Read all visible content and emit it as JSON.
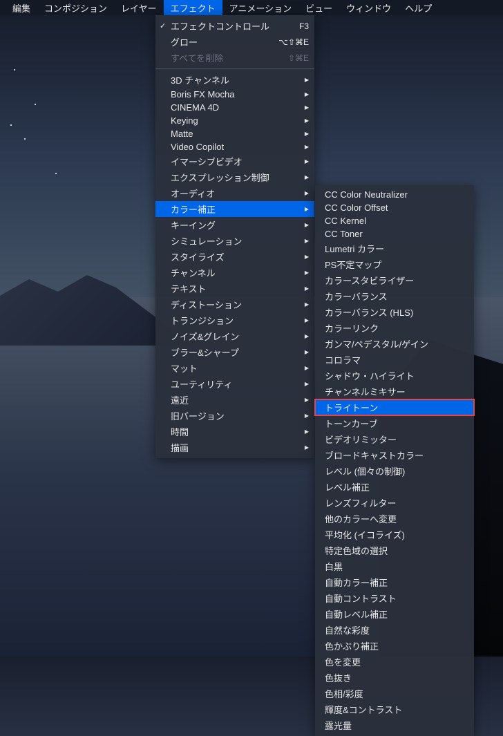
{
  "menubar": {
    "items": [
      {
        "label": "編集"
      },
      {
        "label": "コンポジション"
      },
      {
        "label": "レイヤー"
      },
      {
        "label": "エフェクト",
        "active": true
      },
      {
        "label": "アニメーション"
      },
      {
        "label": "ビュー"
      },
      {
        "label": "ウィンドウ"
      },
      {
        "label": "ヘルプ"
      }
    ]
  },
  "primary_menu": {
    "top_items": [
      {
        "label": "エフェクトコントロール",
        "checked": true,
        "shortcut": "F3"
      },
      {
        "label": "グロー",
        "shortcut": "⌥⇧⌘E"
      },
      {
        "label": "すべてを削除",
        "shortcut": "⇧⌘E",
        "disabled": true
      }
    ],
    "category_items": [
      {
        "label": "3D チャンネル"
      },
      {
        "label": "Boris FX Mocha"
      },
      {
        "label": "CINEMA 4D"
      },
      {
        "label": "Keying"
      },
      {
        "label": "Matte"
      },
      {
        "label": "Video Copilot"
      },
      {
        "label": "イマーシブビデオ"
      },
      {
        "label": "エクスプレッション制御"
      },
      {
        "label": "オーディオ"
      },
      {
        "label": "カラー補正",
        "highlighted": true
      },
      {
        "label": "キーイング"
      },
      {
        "label": "シミュレーション"
      },
      {
        "label": "スタイライズ"
      },
      {
        "label": "チャンネル"
      },
      {
        "label": "テキスト"
      },
      {
        "label": "ディストーション"
      },
      {
        "label": "トランジション"
      },
      {
        "label": "ノイズ&グレイン"
      },
      {
        "label": "ブラー&シャープ"
      },
      {
        "label": "マット"
      },
      {
        "label": "ユーティリティ"
      },
      {
        "label": "遠近"
      },
      {
        "label": "旧バージョン"
      },
      {
        "label": "時間"
      },
      {
        "label": "描画"
      }
    ]
  },
  "sub_menu": {
    "items": [
      {
        "label": "CC Color Neutralizer"
      },
      {
        "label": "CC Color Offset"
      },
      {
        "label": "CC Kernel"
      },
      {
        "label": "CC Toner"
      },
      {
        "label": "Lumetri カラー"
      },
      {
        "label": "PS不定マップ"
      },
      {
        "label": "カラースタビライザー"
      },
      {
        "label": "カラーバランス"
      },
      {
        "label": "カラーバランス (HLS)"
      },
      {
        "label": "カラーリンク"
      },
      {
        "label": "ガンマ/ペデスタル/ゲイン"
      },
      {
        "label": "コロラマ"
      },
      {
        "label": "シャドウ・ハイライト"
      },
      {
        "label": "チャンネルミキサー"
      },
      {
        "label": "トライトーン",
        "highlighted_red": true
      },
      {
        "label": "トーンカーブ"
      },
      {
        "label": "ビデオリミッター"
      },
      {
        "label": "ブロードキャストカラー"
      },
      {
        "label": "レベル (個々の制御)"
      },
      {
        "label": "レベル補正"
      },
      {
        "label": "レンズフィルター"
      },
      {
        "label": "他のカラーへ変更"
      },
      {
        "label": "平均化 (イコライズ)"
      },
      {
        "label": "特定色域の選択"
      },
      {
        "label": "白黒"
      },
      {
        "label": "自動カラー補正"
      },
      {
        "label": "自動コントラスト"
      },
      {
        "label": "自動レベル補正"
      },
      {
        "label": "自然な彩度"
      },
      {
        "label": "色かぶり補正"
      },
      {
        "label": "色を変更"
      },
      {
        "label": "色抜き"
      },
      {
        "label": "色相/彩度"
      },
      {
        "label": "輝度&コントラスト"
      },
      {
        "label": "露光量"
      }
    ]
  }
}
